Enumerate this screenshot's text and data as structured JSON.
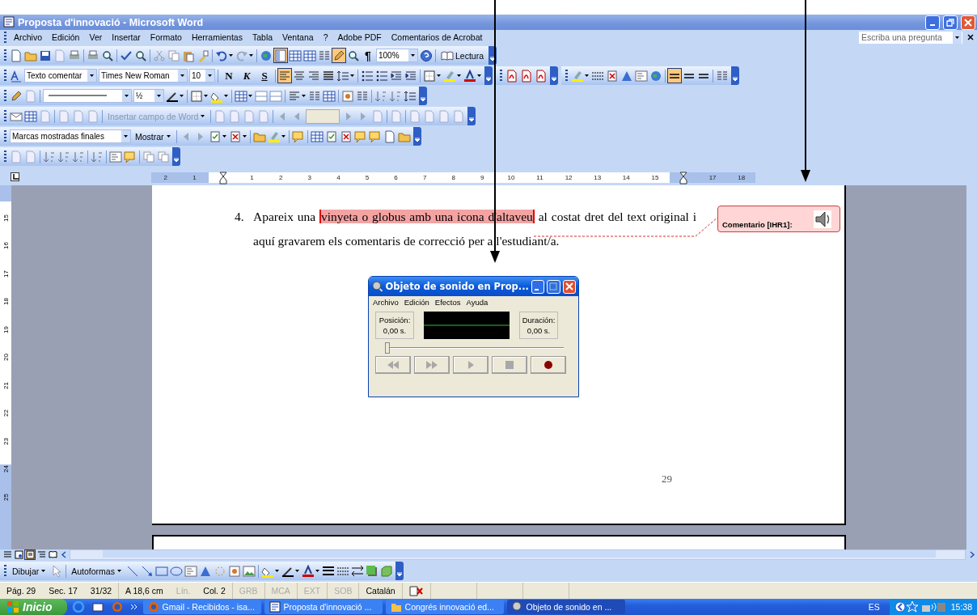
{
  "window": {
    "title": "Proposta d'innovació - Microsoft Word"
  },
  "menu": [
    "Archivo",
    "Edición",
    "Ver",
    "Insertar",
    "Formato",
    "Herramientas",
    "Tabla",
    "Ventana",
    "?",
    "Adobe PDF",
    "Comentarios de Acrobat"
  ],
  "help_box": {
    "placeholder": "Escriba una pregunta"
  },
  "standard_toolbar": {
    "view_toggles": [
      {
        "selected": true
      },
      {
        "selected": false
      },
      {
        "selected": false
      },
      {
        "selected": false
      },
      {
        "selected": true
      }
    ],
    "paragraph_mark": "¶",
    "zoom": "100%",
    "reading_button": "Lectura"
  },
  "formatting_toolbar": {
    "style": "Texto comentar",
    "font": "Times New Roman",
    "size": "10",
    "bold": "N",
    "italic": "K",
    "underline": "S",
    "alignment": [
      {
        "selected": true
      },
      {
        "selected": false
      },
      {
        "selected": false
      },
      {
        "selected": false
      }
    ],
    "balloon_lines": [
      {
        "selected": true
      },
      {
        "selected": false
      },
      {
        "selected": false
      }
    ]
  },
  "tables_toolbar": {
    "line_weight": "½"
  },
  "mail_merge_toolbar": {
    "insert_field": "Insertar campo de Word"
  },
  "reviewing_toolbar": {
    "display": "Marcas mostradas finales",
    "show": "Mostrar"
  },
  "ruler": [
    {
      "kind": "number",
      "text": "2"
    },
    {
      "kind": "number",
      "text": "1"
    },
    {
      "kind": "marker"
    },
    {
      "kind": "number",
      "text": "1"
    },
    {
      "kind": "number",
      "text": "2"
    },
    {
      "kind": "number",
      "text": "3"
    },
    {
      "kind": "number",
      "text": "4"
    },
    {
      "kind": "number",
      "text": "5"
    },
    {
      "kind": "number",
      "text": "6"
    },
    {
      "kind": "number",
      "text": "7"
    },
    {
      "kind": "number",
      "text": "8"
    },
    {
      "kind": "number",
      "text": "9"
    },
    {
      "kind": "number",
      "text": "10"
    },
    {
      "kind": "number",
      "text": "11"
    },
    {
      "kind": "number",
      "text": "12"
    },
    {
      "kind": "number",
      "text": "13"
    },
    {
      "kind": "number",
      "text": "14"
    },
    {
      "kind": "number",
      "text": "15"
    },
    {
      "kind": "marker"
    },
    {
      "kind": "number",
      "text": "17"
    },
    {
      "kind": "number",
      "text": "18"
    }
  ],
  "vertical_ruler": [
    "15",
    "16",
    "17",
    "18",
    "19",
    "20",
    "21",
    "22",
    "23",
    "24",
    "25"
  ],
  "document": {
    "list_number": "4.",
    "paragraph": [
      {
        "text": "Apareix una ",
        "commented": false
      },
      {
        "text": "vinyeta o globus amb una icona d'altaveu",
        "commented": true
      },
      {
        "text": " al costat dret del text original i aquí gravarem els comentaris de correcció per a l'estudiant/a.",
        "commented": false
      }
    ],
    "comment": {
      "label": "Comentario [IHR1]:"
    },
    "page_number": "29"
  },
  "sound_dialog": {
    "title": "Objeto de sonido en Prop...",
    "menu": [
      "Archivo",
      "Edición",
      "Efectos",
      "Ayuda"
    ],
    "position_label": "Posición:",
    "position": "0,00 s.",
    "duration_label": "Duración:",
    "duration": "0,00 s.",
    "seek": {
      "level": 0
    },
    "controls": [
      {
        "kind": "rewind",
        "disabled": true
      },
      {
        "kind": "forward",
        "disabled": true
      },
      {
        "kind": "play",
        "disabled": true
      },
      {
        "kind": "stop",
        "disabled": true
      },
      {
        "kind": "record",
        "disabled": false
      }
    ]
  },
  "view_buttons": [
    {
      "kind": "normal",
      "selected": false
    },
    {
      "kind": "web",
      "selected": false
    },
    {
      "kind": "print",
      "selected": true
    },
    {
      "kind": "outline",
      "selected": false
    },
    {
      "kind": "reading",
      "selected": false
    }
  ],
  "drawing_toolbar": {
    "draw_menu": "Dibujar",
    "autoshapes_menu": "Autoformas"
  },
  "status_bar": [
    {
      "fields": [
        {
          "text": "Pág. 29",
          "disabled": false
        },
        {
          "text": "Sec. 17",
          "disabled": false
        },
        {
          "text": "31/32",
          "disabled": false
        }
      ]
    },
    {
      "fields": [
        {
          "text": "A 18,6 cm",
          "disabled": false
        },
        {
          "text": "Lín.",
          "disabled": true
        },
        {
          "text": "Col. 2",
          "disabled": false
        }
      ]
    },
    {
      "fields": [
        {
          "text": "GRB",
          "disabled": true
        }
      ]
    },
    {
      "fields": [
        {
          "text": "MCA",
          "disabled": true
        }
      ]
    },
    {
      "fields": [
        {
          "text": "EXT",
          "disabled": true
        }
      ]
    },
    {
      "fields": [
        {
          "text": "SOB",
          "disabled": true
        }
      ]
    },
    {
      "fields": [
        {
          "text": "Catalán",
          "disabled": false
        }
      ]
    }
  ],
  "taskbar": {
    "start": "Inicio",
    "tasks": [
      {
        "label": "Gmail - Recibidos - isa...",
        "kind": "browser",
        "selected": false
      },
      {
        "label": "Proposta d'innovació ...",
        "kind": "word",
        "selected": false
      },
      {
        "label": "Congrés innovació ed...",
        "kind": "folder",
        "selected": false
      },
      {
        "label": "Objeto de sonido en ...",
        "kind": "sound",
        "selected": true
      }
    ],
    "language": "ES",
    "clock": "15:38"
  }
}
